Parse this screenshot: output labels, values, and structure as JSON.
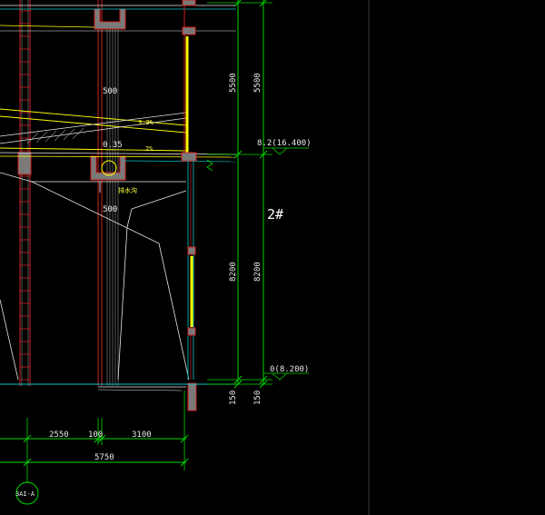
{
  "colors": {
    "background": "#000000",
    "grid_green": "#00d800",
    "wall_red": "#d02020",
    "highlight_yellow": "#ffff00",
    "line_white": "#e8e8e8",
    "line_cyan": "#00c8c8",
    "column_fill": "#7a7a7a"
  },
  "dimensions": {
    "v_5500_outer": "5500",
    "v_5500_inner": "5500",
    "v_8200_outer": "8200",
    "v_8200_inner": "8200",
    "v_150_outer": "150",
    "v_150_inner": "150",
    "h_2550": "2550",
    "h_100": "100",
    "h_3100": "3100",
    "h_5750": "5750"
  },
  "levels": {
    "upper": "8.2(16.400)",
    "ground": "0(8.200)"
  },
  "labels": {
    "note_500_a": "500",
    "note_500_b": "500",
    "ramp_note": "3.2%",
    "level_035": "0.35",
    "slope_note": "2%",
    "drain_note": "排水沟",
    "building_no": "2#",
    "axis_bubble": "3AI-A"
  }
}
